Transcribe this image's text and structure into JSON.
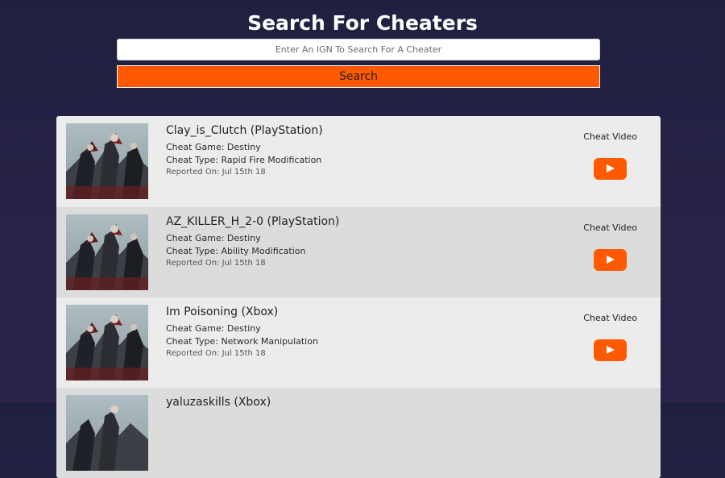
{
  "page": {
    "title": "Search For Cheaters"
  },
  "search": {
    "placeholder": "Enter An IGN To Search For A Cheater",
    "button_label": "Search"
  },
  "colors": {
    "accent": "#ff5a00",
    "background": "#242244"
  },
  "results": [
    {
      "name": "Clay_is_Clutch (PlayStation)",
      "game": "Cheat Game: Destiny",
      "type": "Cheat Type: Rapid Fire Modification",
      "date": "Reported On: Jul 15th 18",
      "video_label": "Cheat Video",
      "video_icon": "play-icon"
    },
    {
      "name": "AZ_KILLER_H_2-0 (PlayStation)",
      "game": "Cheat Game: Destiny",
      "type": "Cheat Type: Ability Modification",
      "date": "Reported On: Jul 15th 18",
      "video_label": "Cheat Video",
      "video_icon": "play-icon"
    },
    {
      "name": "Im Poisoning (Xbox)",
      "game": "Cheat Game: Destiny",
      "type": "Cheat Type: Network Manipulation",
      "date": "Reported On: Jul 15th 18",
      "video_label": "Cheat Video",
      "video_icon": "play-icon"
    },
    {
      "name": "yaluzaskills (Xbox)",
      "game": "",
      "type": "",
      "date": "",
      "video_label": "",
      "video_icon": ""
    }
  ]
}
